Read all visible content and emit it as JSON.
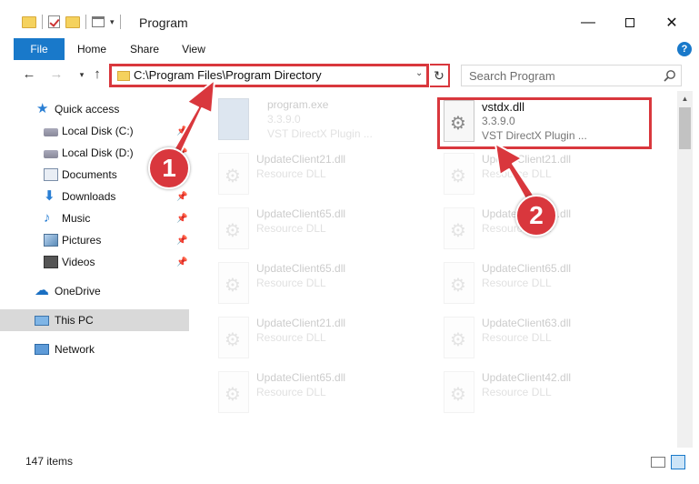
{
  "window": {
    "title": "Program",
    "minimize_glyph": "—",
    "close_glyph": "✕"
  },
  "ribbon": {
    "tabs": [
      "File",
      "Home",
      "Share",
      "View"
    ],
    "help_glyph": "?"
  },
  "nav": {
    "back_glyph": "←",
    "forward_glyph": "→",
    "recent_glyph": "▾",
    "up_glyph": "↑",
    "address": "C:\\Program Files\\Program Directory",
    "search_placeholder": "Search Program",
    "refresh_glyph": "↻",
    "dropdown_glyph": "⌄"
  },
  "sidebar": {
    "items": [
      {
        "label": "Quick access",
        "icon": "star-icon",
        "pinned": false
      },
      {
        "label": "Local Disk (C:)",
        "icon": "disk-icon",
        "pinned": true
      },
      {
        "label": "Local Disk (D:)",
        "icon": "disk-icon",
        "pinned": true
      },
      {
        "label": "Documents",
        "icon": "documents-icon",
        "pinned": true
      },
      {
        "label": "Downloads",
        "icon": "downloads-icon",
        "pinned": true
      },
      {
        "label": "Music",
        "icon": "music-icon",
        "pinned": true
      },
      {
        "label": "Pictures",
        "icon": "pictures-icon",
        "pinned": true
      },
      {
        "label": "Videos",
        "icon": "videos-icon",
        "pinned": true
      },
      {
        "label": "OneDrive",
        "icon": "onedrive-icon",
        "pinned": false
      },
      {
        "label": "This PC",
        "icon": "this-pc-icon",
        "pinned": false,
        "selected": true
      },
      {
        "label": "Network",
        "icon": "network-icon",
        "pinned": false
      }
    ]
  },
  "files": {
    "left": [
      {
        "name": "program.exe",
        "line2": "3.3.9.0",
        "line3": "VST DirectX Plugin ..."
      },
      {
        "name": "UpdateClient21.dll",
        "line2": "Resource DLL"
      },
      {
        "name": "UpdateClient65.dll",
        "line2": "Resource DLL"
      },
      {
        "name": "UpdateClient65.dll",
        "line2": "Resource DLL"
      },
      {
        "name": "UpdateClient21.dll",
        "line2": "Resource DLL"
      },
      {
        "name": "UpdateClient65.dll",
        "line2": "Resource DLL"
      }
    ],
    "right": [
      {
        "name": "vstdx.dll",
        "line2": "3.3.9.0",
        "line3": "VST DirectX Plugin ..."
      },
      {
        "name": "UpdateClient21.dll",
        "line2": "Resource DLL"
      },
      {
        "name": "UpdateClient65.dll",
        "line2": "Resource DLL"
      },
      {
        "name": "UpdateClient65.dll",
        "line2": "Resource DLL"
      },
      {
        "name": "UpdateClient63.dll",
        "line2": "Resource DLL"
      },
      {
        "name": "UpdateClient42.dll",
        "line2": "Resource DLL"
      }
    ]
  },
  "status": {
    "item_count": "147 items"
  },
  "callouts": [
    "1",
    "2"
  ],
  "colors": {
    "accent": "#1979ca",
    "highlight": "#d9373d",
    "selected_bg": "#d9d9d9"
  }
}
